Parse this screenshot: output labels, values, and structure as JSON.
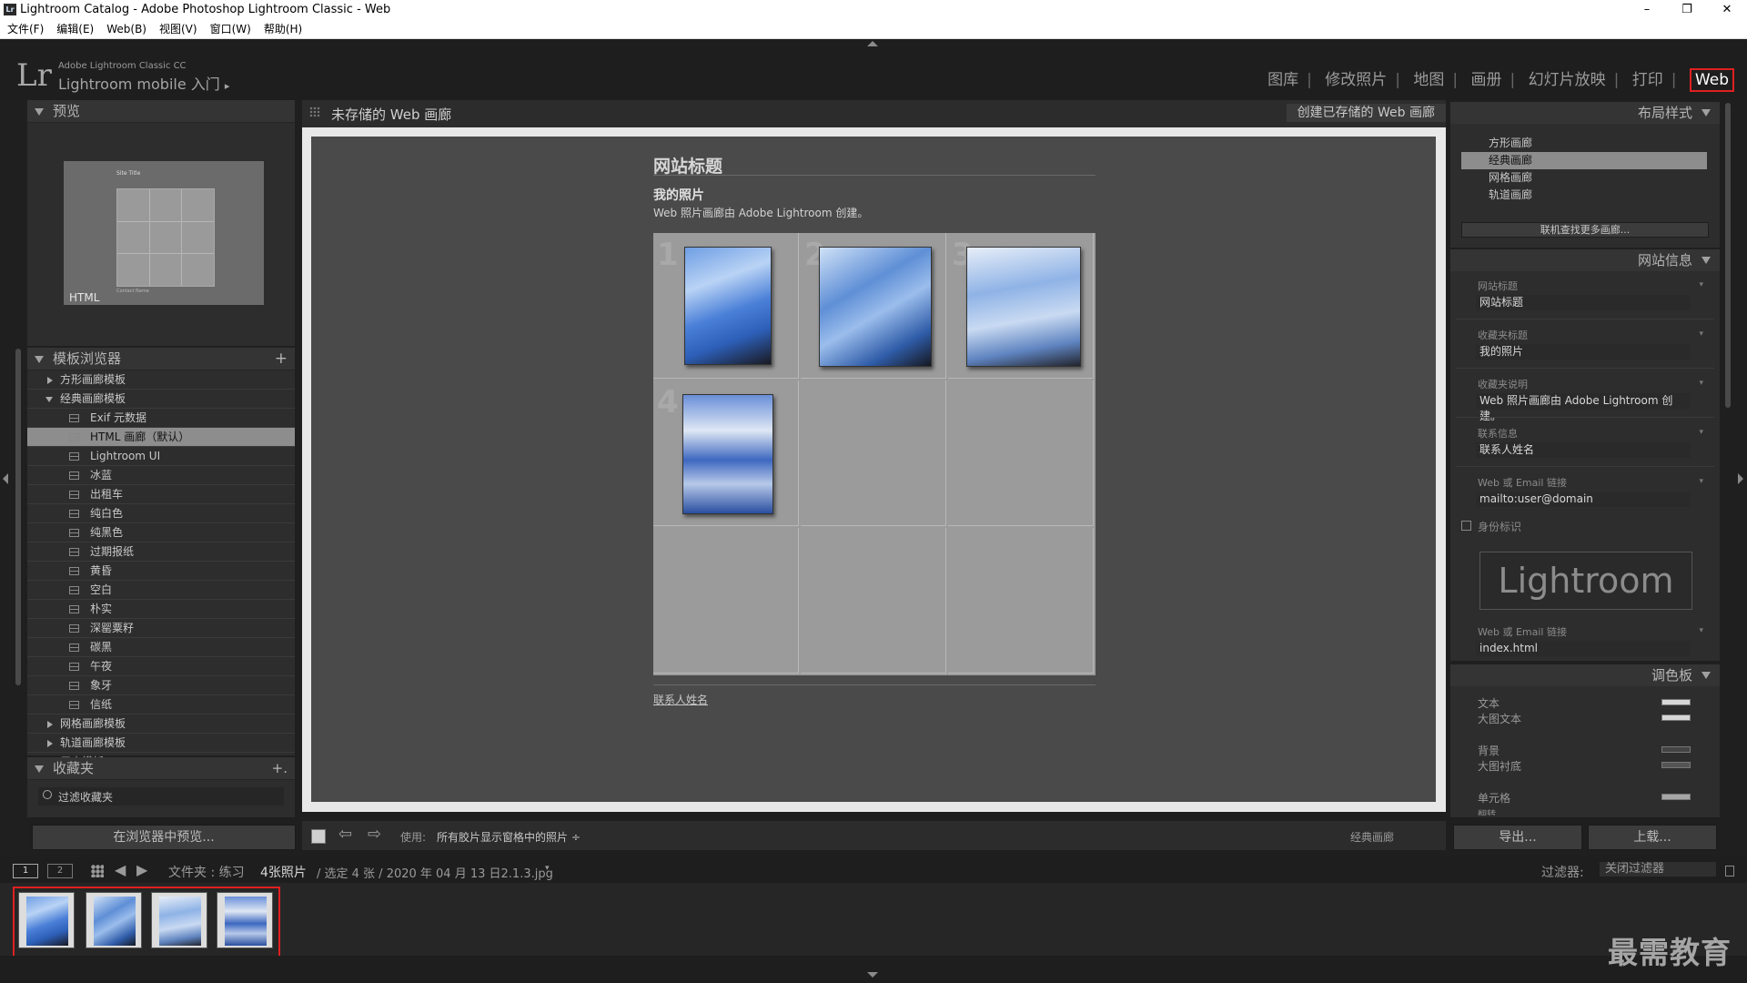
{
  "window": {
    "title": "Lightroom Catalog - Adobe Photoshop Lightroom Classic - Web",
    "app_icon": "Lr",
    "controls": {
      "minimize": "–",
      "restore": "❐",
      "close": "✕"
    }
  },
  "menu": [
    "文件(F)",
    "编辑(E)",
    "Web(B)",
    "视图(V)",
    "窗口(W)",
    "帮助(H)"
  ],
  "identity": {
    "logo": "Lr",
    "product": "Adobe Lightroom Classic CC",
    "mobile": "Lightroom mobile 入门",
    "mobile_arrow": "▸"
  },
  "modules": [
    "图库",
    "修改照片",
    "地图",
    "画册",
    "幻灯片放映",
    "打印",
    "Web"
  ],
  "modules_separator": "|",
  "left": {
    "preview_title": "预览",
    "preview_label": "HTML",
    "preview_site_title": "Site Title",
    "preview_contact": "Contact Name",
    "template_title": "模板浏览器",
    "add_symbol": "+",
    "templates": [
      {
        "label": "方形画廊模板",
        "type": "folder-collapsed"
      },
      {
        "label": "经典画廊模板",
        "type": "folder-expanded"
      },
      {
        "label": "Exif 元数据",
        "type": "item"
      },
      {
        "label": "HTML 画廊（默认）",
        "type": "item-selected"
      },
      {
        "label": "Lightroom UI",
        "type": "item"
      },
      {
        "label": "冰蓝",
        "type": "item"
      },
      {
        "label": "出租车",
        "type": "item"
      },
      {
        "label": "纯白色",
        "type": "item"
      },
      {
        "label": "纯黑色",
        "type": "item"
      },
      {
        "label": "过期报纸",
        "type": "item"
      },
      {
        "label": "黄昏",
        "type": "item"
      },
      {
        "label": "空白",
        "type": "item"
      },
      {
        "label": "朴实",
        "type": "item"
      },
      {
        "label": "深罂粟籽",
        "type": "item"
      },
      {
        "label": "碳黑",
        "type": "item"
      },
      {
        "label": "午夜",
        "type": "item"
      },
      {
        "label": "象牙",
        "type": "item"
      },
      {
        "label": "信纸",
        "type": "item"
      },
      {
        "label": "网格画廊模板",
        "type": "folder-collapsed"
      },
      {
        "label": "轨道画廊模板",
        "type": "folder-collapsed"
      },
      {
        "label": "用户模板",
        "type": "folder-collapsed"
      }
    ],
    "collections_title": "收藏夹",
    "collections_add": "+.",
    "filter_placeholder": "过滤收藏夹",
    "preview_in_browser": "在浏览器中预览..."
  },
  "center": {
    "header_title": "未存储的 Web 画廊",
    "save_button": "创建已存储的 Web 画廊",
    "site_title": "网站标题",
    "collection_title": "我的照片",
    "collection_desc": "Web 照片画廊由 Adobe Lightroom 创建。",
    "cell_numbers": [
      "1",
      "2",
      "3",
      "4"
    ],
    "contact": "联系人姓名",
    "toolbar_use_label": "使用:",
    "toolbar_use_value": "所有胶片显示窗格中的照片 ÷",
    "toolbar_style": "经典画廊"
  },
  "right": {
    "layout_title": "布局样式",
    "layouts": [
      "方形画廊",
      "经典画廊",
      "网格画廊",
      "轨道画廊"
    ],
    "layout_selected": "经典画廊",
    "find_more": "联机查找更多画廊...",
    "siteinfo_title": "网站信息",
    "fields": [
      {
        "label": "网站标题",
        "value": "网站标题"
      },
      {
        "label": "收藏夹标题",
        "value": "我的照片"
      },
      {
        "label": "收藏夹说明",
        "value": "Web 照片画廊由 Adobe Lightroom 创建。"
      },
      {
        "label": "联系信息",
        "value": "联系人姓名"
      },
      {
        "label": "Web 或 Email 链接",
        "value": "mailto:user@domain"
      }
    ],
    "identity_plate_label": "身份标识",
    "identity_plate_text": "Lightroom",
    "web_link_label": "Web 或 Email 链接",
    "web_link_value": "index.html",
    "palette_title": "调色板",
    "palette": [
      {
        "label": "文本",
        "color": "#d7d7d7"
      },
      {
        "label": "大图文本",
        "color": "#d7d7d7"
      },
      {
        "label": "背景",
        "color": "#444444"
      },
      {
        "label": "大图衬底",
        "color": "#555555"
      },
      {
        "label": "单元格",
        "color": "#a6a6a6"
      }
    ],
    "palette_cut": "翻转",
    "export_button": "导出...",
    "upload_button": "上载..."
  },
  "filmstrip": {
    "view1": "1",
    "view2": "2",
    "source": "文件夹 : 练习",
    "count": "4张照片",
    "selection": "/ 选定 4 张 / 2020 年 04 月 13 日2.1.3.jpg",
    "filter_label": "过滤器:",
    "filter_value": "关闭过滤器"
  },
  "watermark": "最需教育",
  "accent": "#e02020"
}
